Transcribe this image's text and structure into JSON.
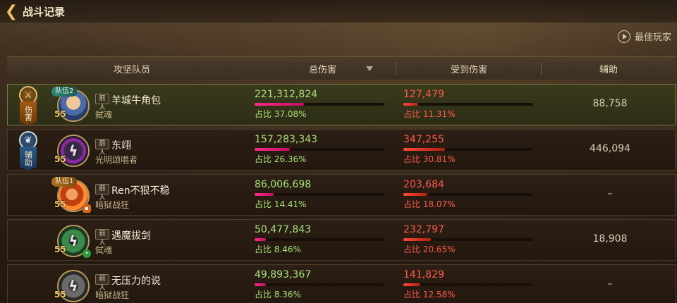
{
  "title": "战斗记录",
  "best_player_label": "最佳玩家",
  "headers": {
    "team": "攻坚队员",
    "total_damage": "总伤害",
    "damage_taken": "受到伤害",
    "assist": "辅助"
  },
  "colors": {
    "damage_green": "#a8e07a",
    "taken_red": "#ff5a4a",
    "bar_pink": "#ff2a8a",
    "level_gold": "#f2c86a"
  },
  "badges": {
    "damage": {
      "icon": "sword-medal-icon",
      "ribbon": "伤害"
    },
    "support": {
      "icon": "wing-medal-icon",
      "ribbon": "辅助"
    }
  },
  "rows": [
    {
      "team_tag": "队伍2",
      "level": "55",
      "prefix": "前 人",
      "name": "羊城牛角包",
      "class": "弑魂",
      "damage": "221,312,824",
      "damage_pct": "占比 37.08%",
      "damage_ratio": 0.3708,
      "taken": "127,479",
      "taken_pct": "占比 11.31%",
      "taken_ratio": 0.1131,
      "assist": "88,758"
    },
    {
      "team_tag": "",
      "level": "55",
      "prefix": "前 人",
      "name": "东翊",
      "class": "光明颂唱者",
      "damage": "157,283,343",
      "damage_pct": "占比 26.36%",
      "damage_ratio": 0.2636,
      "taken": "347,255",
      "taken_pct": "占比 30.81%",
      "taken_ratio": 0.3081,
      "assist": "446,094"
    },
    {
      "team_tag": "队伍1",
      "level": "55",
      "prefix": "前 人",
      "name": "Ren不狠不稳",
      "class": "暗狱战狂",
      "damage": "86,006,698",
      "damage_pct": "占比 14.41%",
      "damage_ratio": 0.1441,
      "taken": "203,684",
      "taken_pct": "占比 18.07%",
      "taken_ratio": 0.1807,
      "assist": "–"
    },
    {
      "team_tag": "",
      "level": "55",
      "prefix": "前 人",
      "name": "遇魔拔剑",
      "class": "弑魂",
      "damage": "50,477,843",
      "damage_pct": "占比 8.46%",
      "damage_ratio": 0.0846,
      "taken": "232,797",
      "taken_pct": "占比 20.65%",
      "taken_ratio": 0.2065,
      "assist": "18,908"
    },
    {
      "team_tag": "",
      "level": "55",
      "prefix": "前 人",
      "name": "无压力的说",
      "class": "暗狱战狂",
      "damage": "49,893,367",
      "damage_pct": "占比 8.36%",
      "damage_ratio": 0.0836,
      "taken": "141,829",
      "taken_pct": "占比 12.58%",
      "taken_ratio": 0.1258,
      "assist": "–"
    }
  ]
}
